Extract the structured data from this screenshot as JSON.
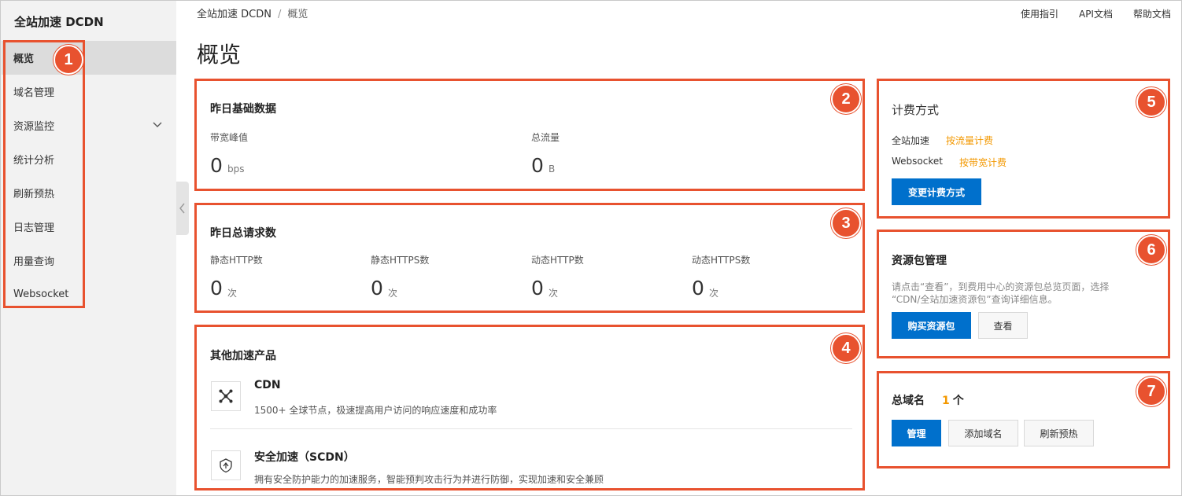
{
  "sidebar": {
    "title": "全站加速 DCDN",
    "items": [
      {
        "label": "概览",
        "active": true
      },
      {
        "label": "域名管理"
      },
      {
        "label": "资源监控",
        "expandable": true
      },
      {
        "label": "统计分析"
      },
      {
        "label": "刷新预热"
      },
      {
        "label": "日志管理"
      },
      {
        "label": "用量查询"
      },
      {
        "label": "Websocket"
      }
    ]
  },
  "header": {
    "breadcrumb": [
      "全站加速 DCDN",
      "概览"
    ],
    "breadcrumb_separator": "/",
    "links": [
      "使用指引",
      "API文档",
      "帮助文档"
    ],
    "page_title": "概览"
  },
  "annotations": [
    "1",
    "2",
    "3",
    "4",
    "5",
    "6",
    "7"
  ],
  "basic_data": {
    "title": "昨日基础数据",
    "metrics": [
      {
        "label": "带宽峰值",
        "value": "0",
        "unit": "bps"
      },
      {
        "label": "总流量",
        "value": "0",
        "unit": "B"
      }
    ]
  },
  "requests": {
    "title": "昨日总请求数",
    "metrics": [
      {
        "label": "静态HTTP数",
        "value": "0",
        "unit": "次"
      },
      {
        "label": "静态HTTPS数",
        "value": "0",
        "unit": "次"
      },
      {
        "label": "动态HTTP数",
        "value": "0",
        "unit": "次"
      },
      {
        "label": "动态HTTPS数",
        "value": "0",
        "unit": "次"
      }
    ]
  },
  "products": {
    "title": "其他加速产品",
    "items": [
      {
        "name": "CDN",
        "desc": "1500+ 全球节点，极速提高用户访问的响应速度和成功率",
        "icon": "cdn-network-icon"
      },
      {
        "name": "安全加速（SCDN）",
        "desc": "拥有安全防护能力的加速服务，智能预判攻击行为并进行防御，实现加速和安全兼顾",
        "icon": "shield-recycle-icon"
      }
    ]
  },
  "billing": {
    "title": "计费方式",
    "rows": [
      {
        "key": "全站加速",
        "value": "按流量计费"
      },
      {
        "key": "Websocket",
        "value": "按带宽计费"
      }
    ],
    "button": "变更计费方式"
  },
  "resource_pack": {
    "title": "资源包管理",
    "desc_line1": "请点击“查看”，到费用中心的资源包总览页面，选择",
    "desc_line2": "“CDN/全站加速资源包”查询详细信息。",
    "buy_button": "购买资源包",
    "view_button": "查看"
  },
  "domains": {
    "title": "总域名",
    "count": "1",
    "count_unit": "个",
    "buttons": [
      "管理",
      "添加域名",
      "刷新预热"
    ]
  },
  "colors": {
    "annotation": "#e8522f",
    "primary": "#0070cc",
    "highlight": "#f39800",
    "sidebar_bg": "#f2f2f2"
  }
}
